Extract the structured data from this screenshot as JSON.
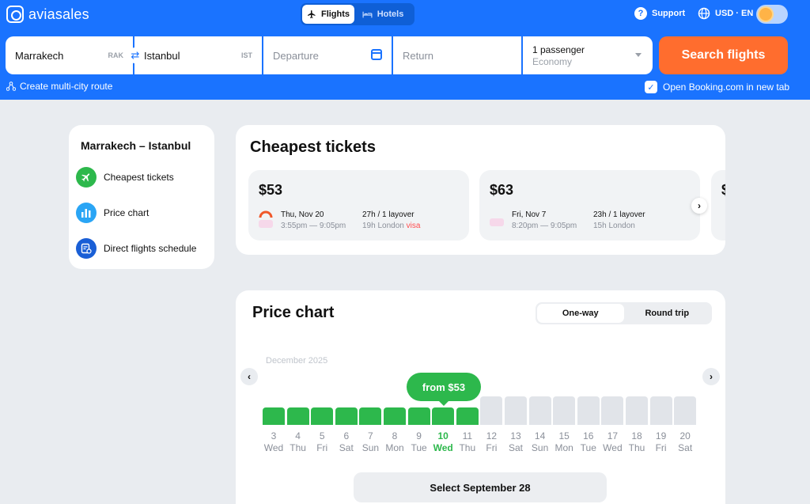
{
  "header": {
    "logo_text": "aviasales",
    "tabs": [
      {
        "label": "Flights",
        "icon": "plane-icon",
        "active": true
      },
      {
        "label": "Hotels",
        "icon": "bed-icon",
        "active": false
      }
    ],
    "support_label": "Support",
    "locale_label": "USD · EN"
  },
  "search": {
    "origin": {
      "city": "Marrakech",
      "code": "RAK"
    },
    "destination": {
      "city": "Istanbul",
      "code": "IST"
    },
    "departure_placeholder": "Departure",
    "return_placeholder": "Return",
    "passengers": "1 passenger",
    "cabin": "Economy",
    "button_label": "Search flights",
    "multicity_label": "Create multi-city route",
    "booking_label": "Open Booking.com in new tab"
  },
  "sidebar": {
    "title": "Marrakech – Istanbul",
    "items": [
      {
        "label": "Cheapest tickets",
        "icon": "plane-icon",
        "color": "#2db84c"
      },
      {
        "label": "Price chart",
        "icon": "bar-chart-icon",
        "color": "#2aa5f5"
      },
      {
        "label": "Direct flights schedule",
        "icon": "schedule-icon",
        "color": "#1a5fd6"
      }
    ]
  },
  "cheapest": {
    "title": "Cheapest tickets",
    "tickets": [
      {
        "price": "$53",
        "date": "Thu, Nov 20",
        "times": "3:55pm — 9:05pm",
        "duration": "27h",
        "layovers": "1 layover",
        "layover_detail": "19h London",
        "warning": "visa"
      },
      {
        "price": "$63",
        "date": "Fri, Nov 7",
        "times": "8:20pm — 9:05pm",
        "duration": "23h",
        "layovers": "1 layover",
        "layover_detail": "15h London",
        "warning": ""
      }
    ]
  },
  "price_chart": {
    "title": "Price chart",
    "trip_options": [
      "One-way",
      "Round trip"
    ],
    "active_trip": "One-way",
    "month": "December 2025",
    "tooltip": "from $53",
    "select_button": "Select September 28",
    "colors": {
      "available": "#2db84c",
      "unavailable": "#e1e4e9"
    }
  },
  "chart_data": {
    "type": "bar",
    "categories": [
      "3",
      "4",
      "5",
      "6",
      "7",
      "8",
      "9",
      "10",
      "11",
      "12",
      "13",
      "14",
      "15",
      "16",
      "17",
      "18",
      "19",
      "20"
    ],
    "weekdays": [
      "Wed",
      "Thu",
      "Fri",
      "Sat",
      "Sun",
      "Mon",
      "Tue",
      "Wed",
      "Thu",
      "Fri",
      "Sat",
      "Sun",
      "Mon",
      "Tue",
      "Wed",
      "Thu",
      "Fri",
      "Sat"
    ],
    "available": [
      true,
      true,
      true,
      true,
      true,
      true,
      true,
      true,
      true,
      false,
      false,
      false,
      false,
      false,
      false,
      false,
      false,
      false
    ],
    "selected_index": 7,
    "values": [
      53,
      53,
      53,
      53,
      53,
      53,
      53,
      53,
      53,
      null,
      null,
      null,
      null,
      null,
      null,
      null,
      null,
      null
    ]
  }
}
